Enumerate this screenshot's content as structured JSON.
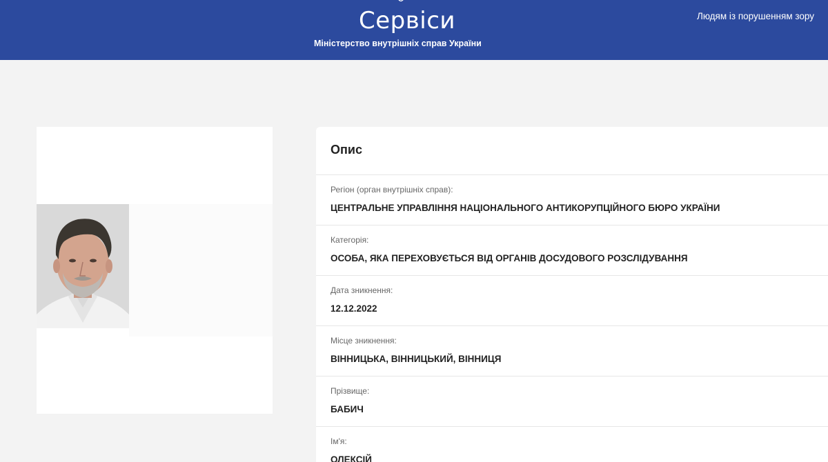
{
  "header": {
    "title": "Сервіси",
    "subtitle": "Міністерство внутрішніх справ України",
    "accessibility_link": "Людям із порушенням зору",
    "colors": {
      "background": "#2c4a9e",
      "text": "#ffffff"
    }
  },
  "photo": {
    "icon": "person-photo"
  },
  "description": {
    "title": "Опис",
    "fields": [
      {
        "label": "Регіон (орган внутрішніх справ):",
        "value": "ЦЕНТРАЛЬНЕ УПРАВЛІННЯ НАЦІОНАЛЬНОГО АНТИКОРУПЦІЙНОГО БЮРО УКРАЇНИ"
      },
      {
        "label": "Категорія:",
        "value": "ОСОБА, ЯКА ПЕРЕХОВУЄТЬСЯ ВІД ОРГАНІВ ДОСУДОВОГО РОЗСЛІДУВАННЯ"
      },
      {
        "label": "Дата зникнення:",
        "value": "12.12.2022"
      },
      {
        "label": "Місце зникнення:",
        "value": "ВІННИЦЬКА, ВІННИЦЬКИЙ, ВІННИЦЯ"
      },
      {
        "label": "Прізвище:",
        "value": "БАБИЧ"
      },
      {
        "label": "Ім'я:",
        "value": "ОЛЕКСІЙ"
      }
    ]
  }
}
